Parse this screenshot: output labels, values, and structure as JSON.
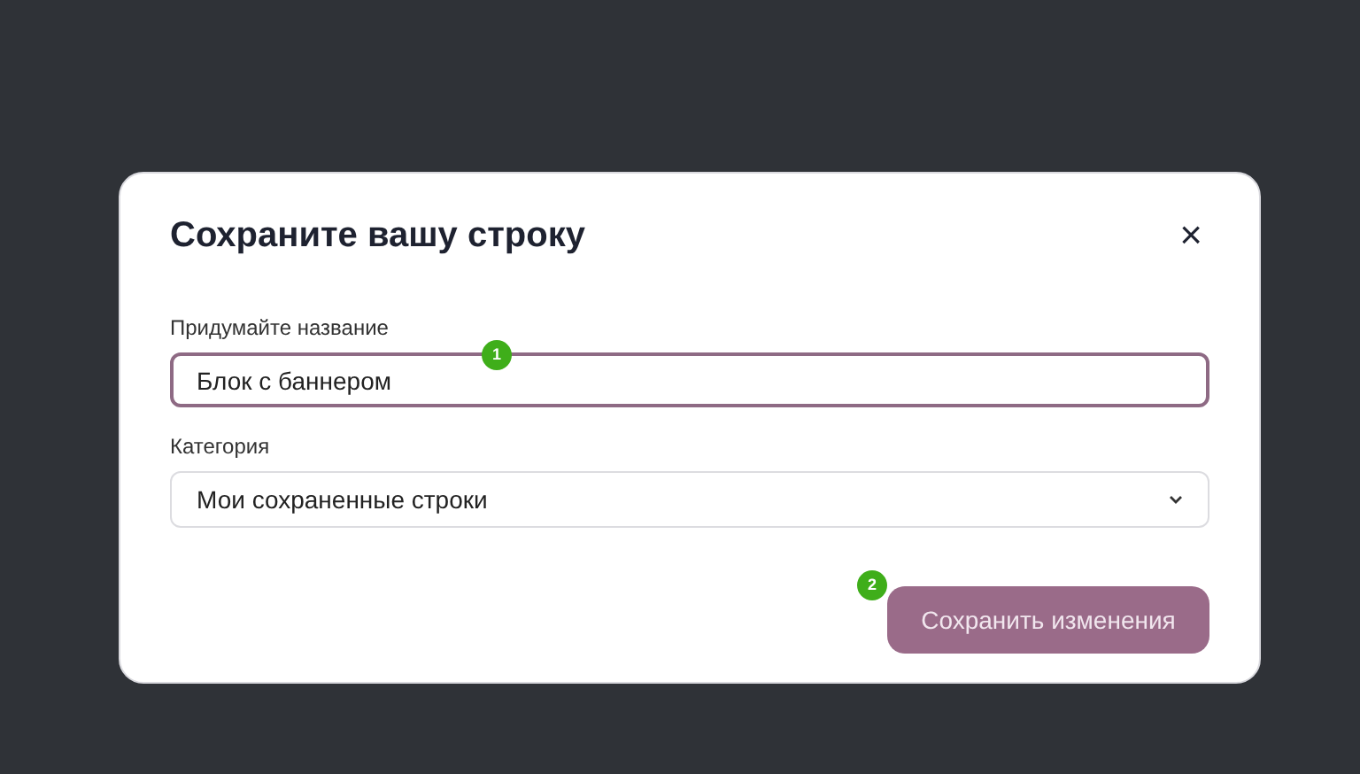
{
  "dialog": {
    "title": "Сохраните вашу строку",
    "close": "×",
    "name_field": {
      "label": "Придумайте название",
      "value": "Блок с баннером"
    },
    "category_field": {
      "label": "Категория",
      "value": "Мои сохраненные строки"
    },
    "save_button": {
      "label": "Сохранить изменения",
      "disabled": true
    },
    "markers": [
      "1",
      "2"
    ]
  }
}
